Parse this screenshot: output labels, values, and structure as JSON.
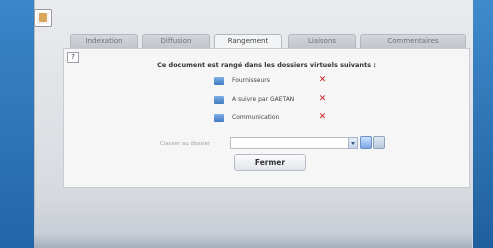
{
  "header": {
    "doc_icon": "document-icon"
  },
  "tabs": [
    {
      "label": "Indexation",
      "active": false
    },
    {
      "label": "Diffusion",
      "active": false
    },
    {
      "label": "Rangement",
      "active": true
    },
    {
      "label": "Liaisons",
      "active": false
    },
    {
      "label": "Commentaires",
      "active": false
    }
  ],
  "panel": {
    "help_label": "?",
    "heading": "Ce document est rangé dans les dossiers virtuels suivants :",
    "folders": [
      {
        "name": "Fournisseurs"
      },
      {
        "name": "A suivre par GAETAN"
      },
      {
        "name": "Communication"
      }
    ],
    "add_label": "Classer au dossier",
    "add_value": "",
    "close_label": "Fermer"
  },
  "colors": {
    "remove": "#cc1f1f",
    "folder": "#3f79c1",
    "desktop": "#2a6fb0"
  }
}
